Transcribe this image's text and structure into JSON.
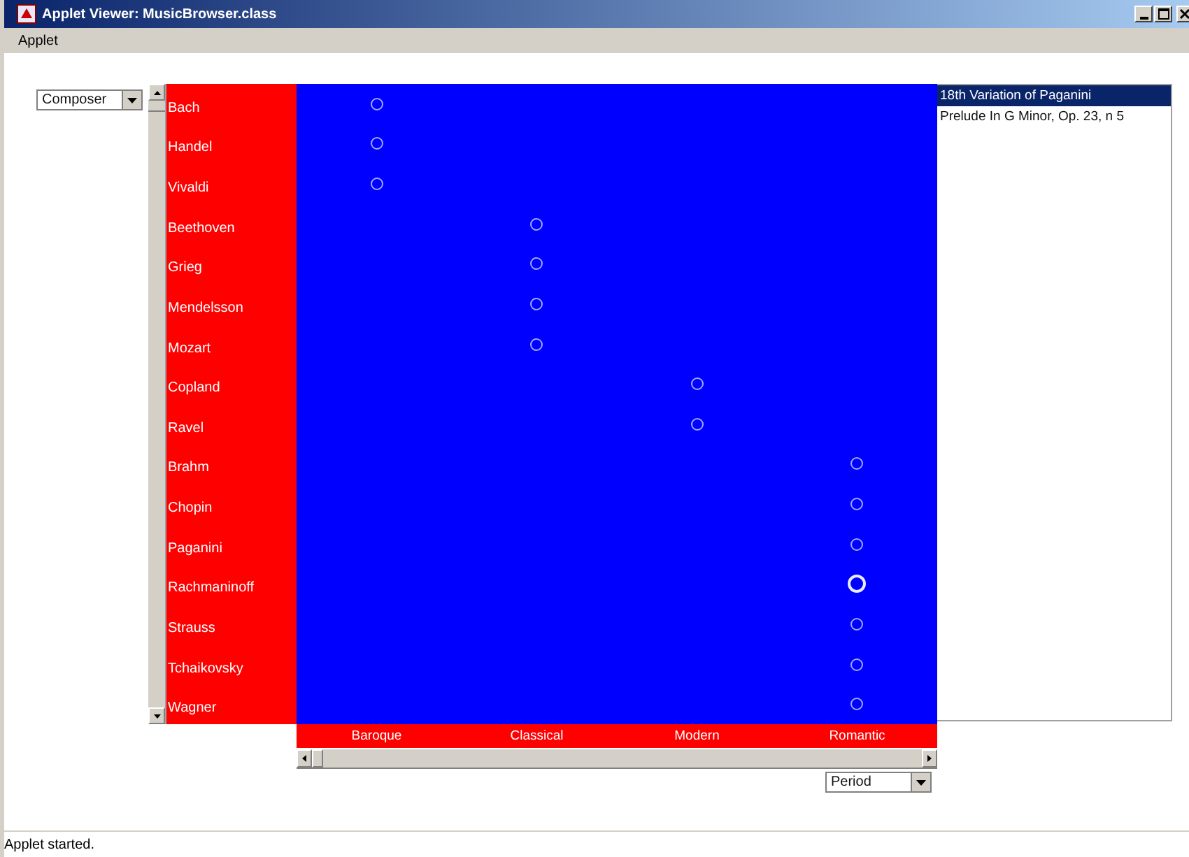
{
  "window": {
    "title": "Applet Viewer: MusicBrowser.class"
  },
  "menu": [
    "Applet"
  ],
  "composer_dropdown": {
    "value": "Composer"
  },
  "periods": [
    {
      "label": "Baroque",
      "composers": [
        {
          "name": "Bach",
          "selected": false
        },
        {
          "name": "Handel",
          "selected": false
        },
        {
          "name": "Vivaldi",
          "selected": false
        }
      ]
    },
    {
      "label": "Classical",
      "composers": [
        {
          "name": "Beethoven",
          "selected": false
        },
        {
          "name": "Grieg",
          "selected": false
        },
        {
          "name": "Mendelsson",
          "selected": false
        },
        {
          "name": "Mozart",
          "selected": false
        }
      ]
    },
    {
      "label": "Modern",
      "composers": [
        {
          "name": "Copland",
          "selected": false
        },
        {
          "name": "Ravel",
          "selected": false
        }
      ]
    },
    {
      "label": "Romantic",
      "composers": [
        {
          "name": "Brahm",
          "selected": false
        },
        {
          "name": "Chopin",
          "selected": false
        },
        {
          "name": "Paganini",
          "selected": false
        },
        {
          "name": "Rachmaninoff",
          "selected": true
        },
        {
          "name": "Strauss",
          "selected": false
        },
        {
          "name": "Tchaikovsky",
          "selected": false
        },
        {
          "name": "Wagner",
          "selected": false
        }
      ]
    }
  ],
  "works": [
    {
      "title": "18th Variation of Paganini",
      "selected": true
    },
    {
      "title": "Prelude In G Minor, Op. 23, n 5",
      "selected": false
    }
  ],
  "period_dropdown": {
    "value": "Period"
  },
  "status_bar": "Applet started."
}
